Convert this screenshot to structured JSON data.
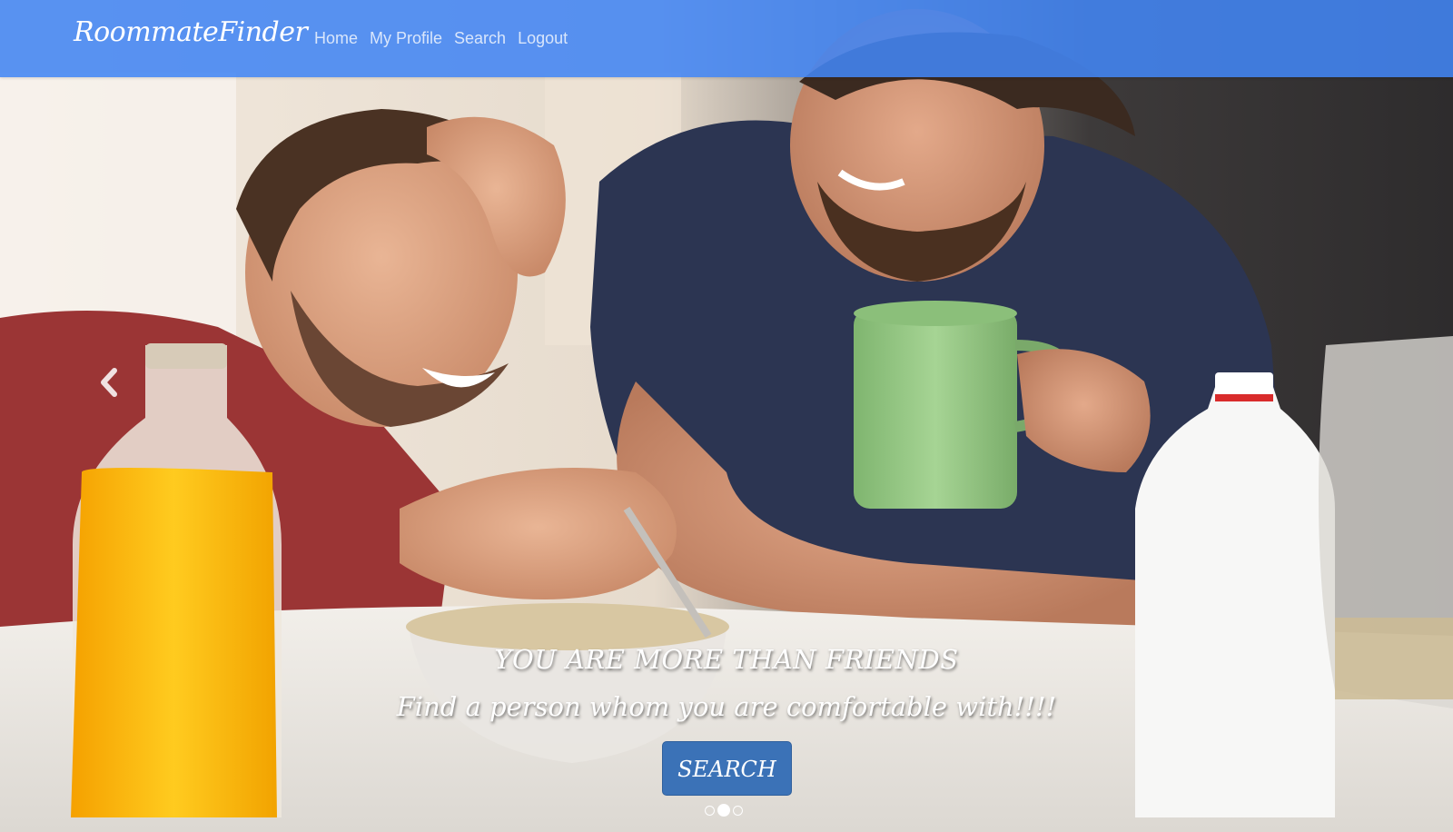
{
  "navbar": {
    "brand": "RoommateFinder",
    "links": [
      "Home",
      "My Profile",
      "Search",
      "Logout"
    ]
  },
  "carousel": {
    "headline": "YOU ARE MORE THAN FRIENDS",
    "subheadline": "Find a person whom you are comfortable with!!!!",
    "button_label": "SEARCH",
    "slide_count": 3,
    "active_slide": 2,
    "prev_icon": "chevron-left-icon"
  },
  "colors": {
    "navbar": "#4285f4",
    "button": "#3b72b7"
  }
}
